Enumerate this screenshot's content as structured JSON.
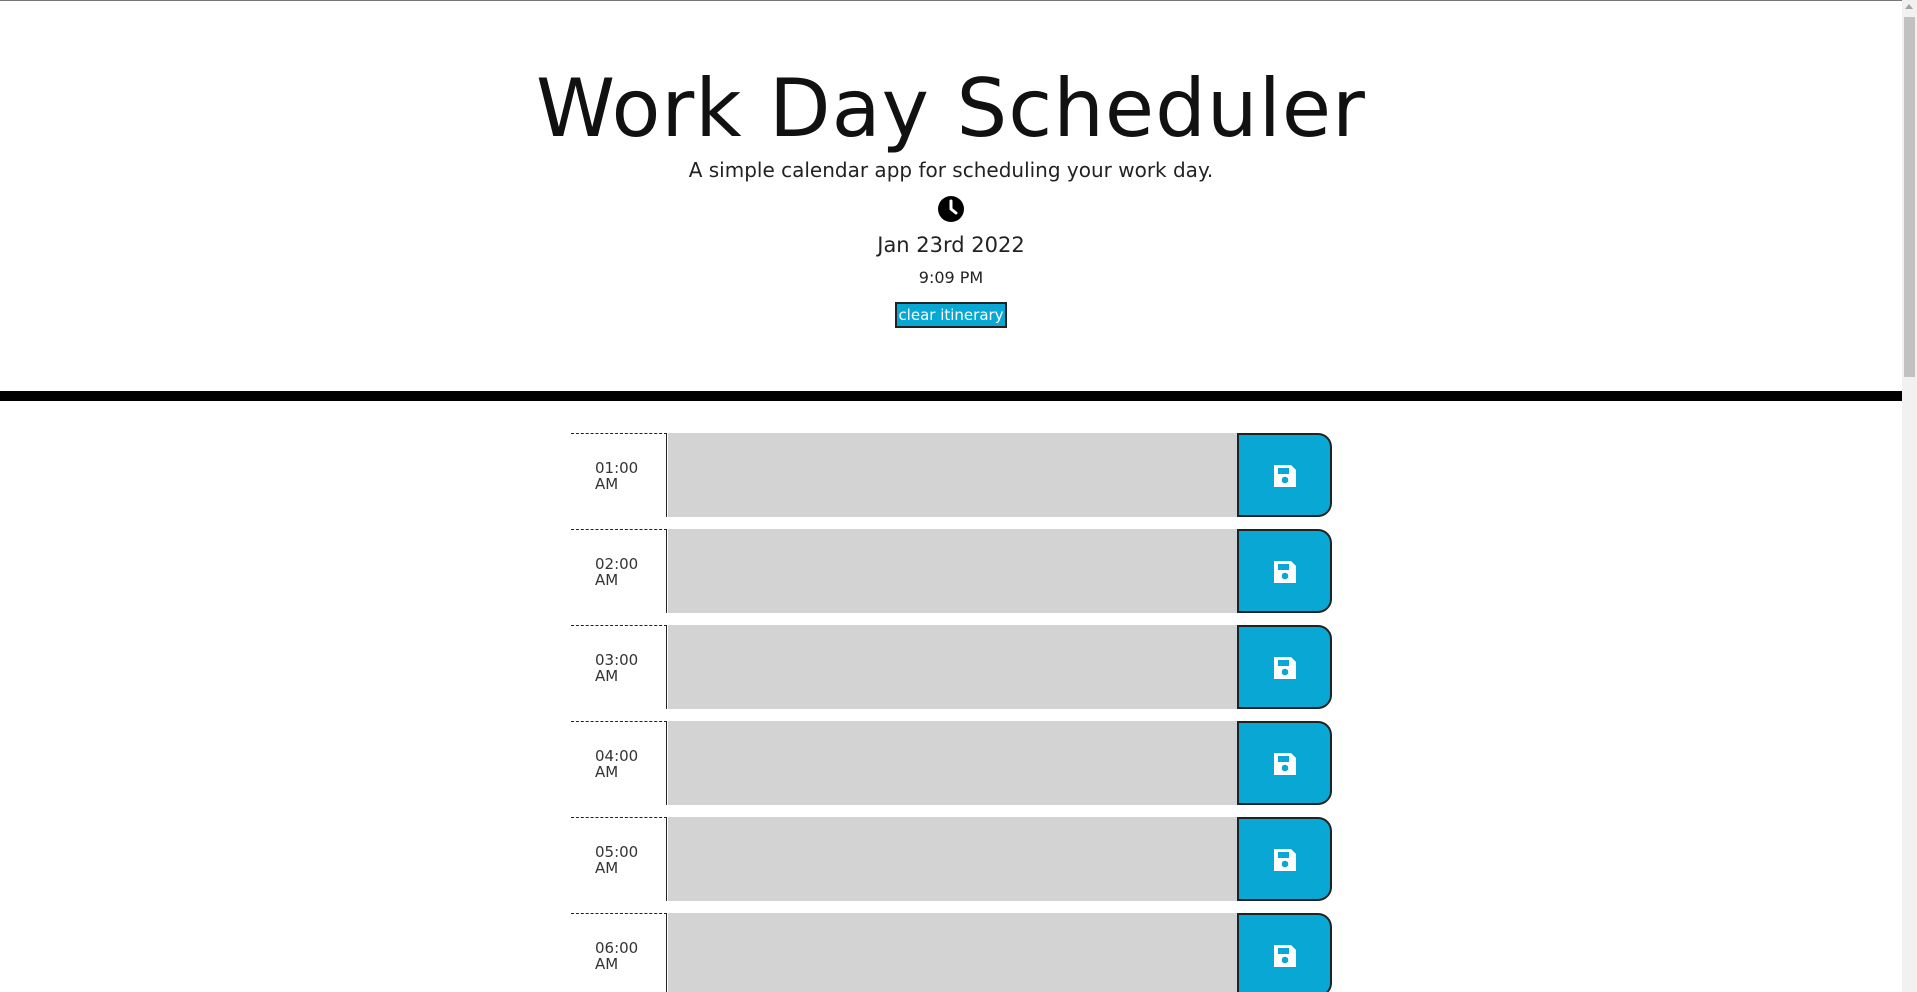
{
  "header": {
    "title": "Work Day Scheduler",
    "subtitle": "A simple calendar app for scheduling your work day.",
    "clock_icon": "clock-icon",
    "date": "Jan 23rd 2022",
    "time": "9:09 PM",
    "clear_button_label": "clear itinerary"
  },
  "colors": {
    "accent": "#09a7d3",
    "past_block": "#d3d3d3",
    "divider": "#000000"
  },
  "timeblocks": [
    {
      "hour": "01:00",
      "period": "AM",
      "text": "",
      "save_icon": "save-icon"
    },
    {
      "hour": "02:00",
      "period": "AM",
      "text": "",
      "save_icon": "save-icon"
    },
    {
      "hour": "03:00",
      "period": "AM",
      "text": "",
      "save_icon": "save-icon"
    },
    {
      "hour": "04:00",
      "period": "AM",
      "text": "",
      "save_icon": "save-icon"
    },
    {
      "hour": "05:00",
      "period": "AM",
      "text": "",
      "save_icon": "save-icon"
    },
    {
      "hour": "06:00",
      "period": "AM",
      "text": "",
      "save_icon": "save-icon"
    }
  ]
}
